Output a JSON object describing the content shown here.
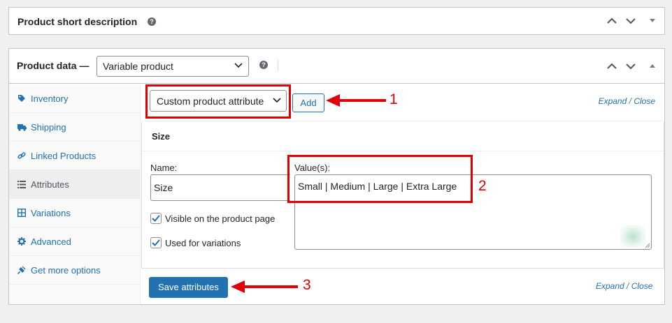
{
  "short_description": {
    "title": "Product short description",
    "help_glyph": "?"
  },
  "product_data": {
    "title": "Product data —",
    "type_select_value": "Variable product",
    "help_glyph": "?"
  },
  "tabs": [
    {
      "label": "Inventory",
      "icon": "tag-icon"
    },
    {
      "label": "Shipping",
      "icon": "truck-icon"
    },
    {
      "label": "Linked Products",
      "icon": "link-icon"
    },
    {
      "label": "Attributes",
      "icon": "list-icon",
      "active": true
    },
    {
      "label": "Variations",
      "icon": "grid-icon"
    },
    {
      "label": "Advanced",
      "icon": "gear-icon"
    },
    {
      "label": "Get more options",
      "icon": "plug-icon"
    }
  ],
  "attributes": {
    "select_value": "Custom product attribute",
    "add_label": "Add",
    "expand_label": "Expand",
    "close_label": "Close",
    "slash": "/",
    "attribute": {
      "heading": "Size",
      "name_label": "Name:",
      "name_value": "Size",
      "values_label": "Value(s):",
      "values_value": "Small | Medium | Large | Extra Large",
      "visible_label": "Visible on the product page",
      "visible_checked": true,
      "variations_label": "Used for variations",
      "variations_checked": true
    },
    "save_label": "Save attributes"
  },
  "annotations": {
    "n1": "1",
    "n2": "2",
    "n3": "3",
    "color": "#e00000"
  },
  "colors": {
    "accent": "#2271b1",
    "annotation": "#e00000",
    "background": "#f0f0f1"
  }
}
